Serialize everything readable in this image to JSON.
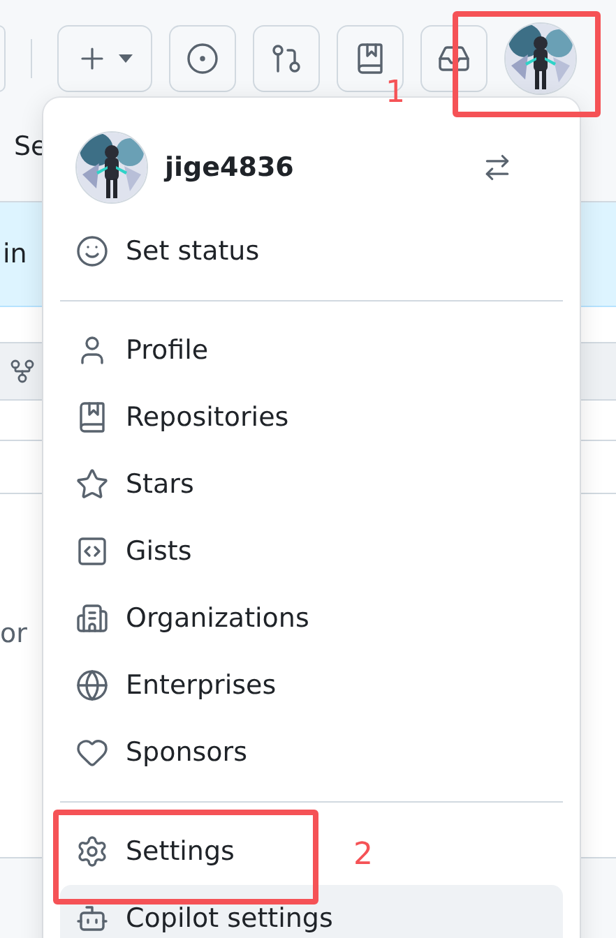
{
  "background": {
    "tab_text": "Se",
    "banner_text": "in",
    "body_text": "or"
  },
  "menu": {
    "username": "jige4836",
    "status_item": "Set status",
    "groups": [
      [
        {
          "label": "Profile",
          "highlighted": false
        },
        {
          "label": "Repositories",
          "highlighted": false
        },
        {
          "label": "Stars",
          "highlighted": false
        },
        {
          "label": "Gists",
          "highlighted": false
        },
        {
          "label": "Organizations",
          "highlighted": false
        },
        {
          "label": "Enterprises",
          "highlighted": false
        },
        {
          "label": "Sponsors",
          "highlighted": false
        }
      ],
      [
        {
          "label": "Settings",
          "highlighted": false
        },
        {
          "label": "Copilot settings",
          "highlighted": true
        }
      ]
    ]
  },
  "annotations": [
    {
      "label": "1"
    },
    {
      "label": "2"
    }
  ]
}
